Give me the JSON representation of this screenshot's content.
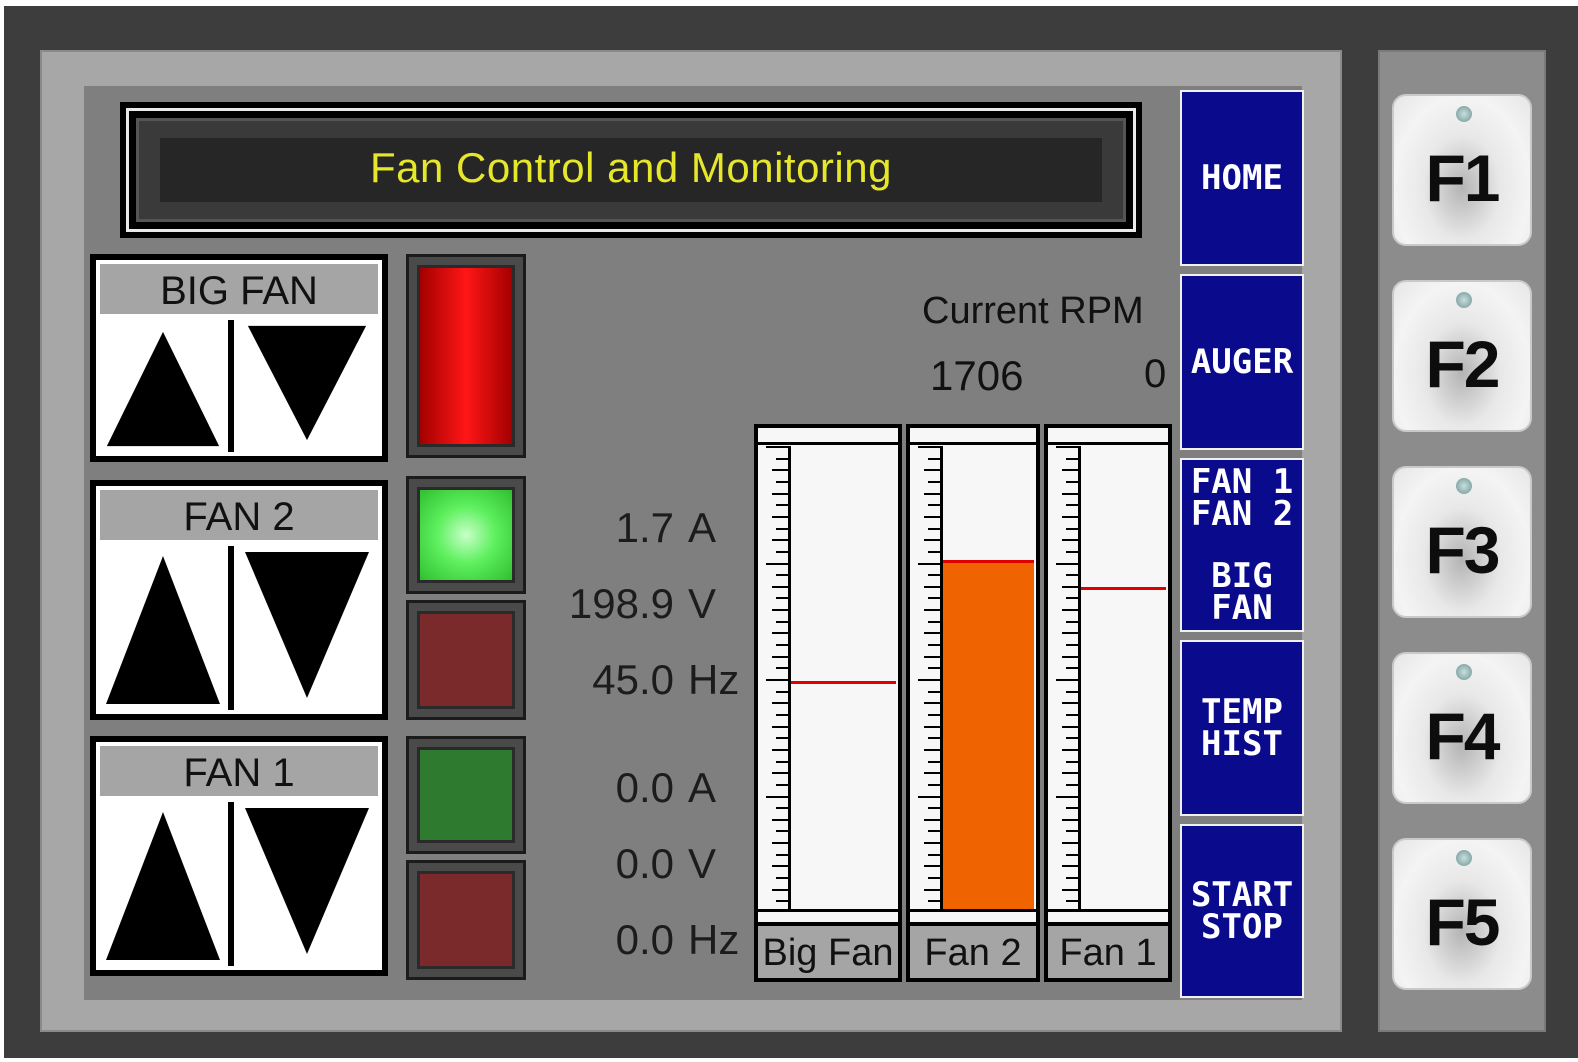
{
  "title": "Fan Control and Monitoring",
  "fans": [
    {
      "label": "BIG FAN"
    },
    {
      "label": "FAN 2"
    },
    {
      "label": "FAN 1"
    }
  ],
  "status_lamps": [
    {
      "state": "red-on",
      "color": "#ff1616"
    },
    {
      "state": "green-on",
      "color": "#5ef05e"
    },
    {
      "state": "red-off",
      "color": "#7a2a2a"
    },
    {
      "state": "green-off",
      "color": "#2e7a2e"
    },
    {
      "state": "red-off",
      "color": "#7a2a2a"
    }
  ],
  "readouts": {
    "fan2": [
      {
        "value": "1.7",
        "unit": "A"
      },
      {
        "value": "198.9",
        "unit": "V"
      },
      {
        "value": "45.0",
        "unit": "Hz"
      }
    ],
    "fan1": [
      {
        "value": "0.0",
        "unit": "A"
      },
      {
        "value": "0.0",
        "unit": "V"
      },
      {
        "value": "0.0",
        "unit": "Hz"
      }
    ]
  },
  "rpm": {
    "label": "Current RPM",
    "value": "1706",
    "zero": "0"
  },
  "meters": [
    {
      "name": "Big Fan",
      "fill_fraction": 0.0,
      "setpoint_fraction": 0.49
    },
    {
      "name": "Fan 2",
      "fill_fraction": 0.75,
      "setpoint_fraction": null
    },
    {
      "name": "Fan 1",
      "fill_fraction": 0.0,
      "setpoint_fraction": 0.69
    }
  ],
  "nav": [
    {
      "lines": [
        "HOME"
      ]
    },
    {
      "lines": [
        "AUGER"
      ]
    },
    {
      "lines": [
        "FAN 1",
        "FAN 2",
        "",
        "BIG",
        "FAN"
      ]
    },
    {
      "lines": [
        "TEMP",
        "HIST"
      ]
    },
    {
      "lines": [
        "START",
        "STOP"
      ]
    }
  ],
  "function_keys": [
    "F1",
    "F2",
    "F3",
    "F4",
    "F5"
  ],
  "colors": {
    "title_text": "#e6e62a",
    "nav_button": "#0a0a8c",
    "meter_fill": "#ef6400",
    "setpoint_line": "#e00000"
  }
}
